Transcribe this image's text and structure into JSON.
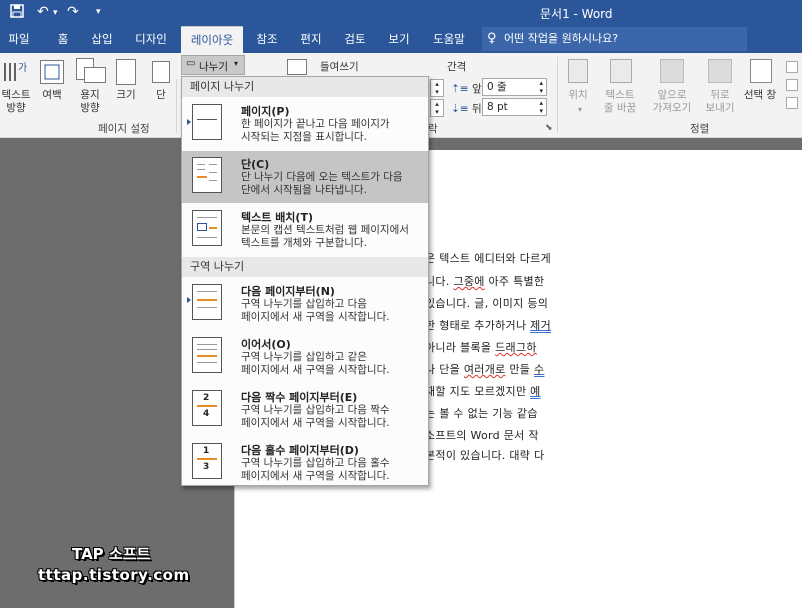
{
  "window": {
    "title": "문서1 - Word"
  },
  "qat": {
    "save_icon": "save-icon",
    "undo_icon": "undo-icon",
    "redo_icon": "redo-icon"
  },
  "tabs": [
    "파일",
    "홈",
    "삽입",
    "디자인",
    "레이아웃",
    "참조",
    "편지",
    "검토",
    "보기",
    "도움말"
  ],
  "tell_me": {
    "placeholder": "어떤 작업을 원하시나요?"
  },
  "ribbon": {
    "text_direction": [
      "텍스트",
      "방향"
    ],
    "margins": "여백",
    "orientation": [
      "용지",
      "방향"
    ],
    "size": "크기",
    "columns": "단",
    "breaks": "나누기",
    "page_setup": "페이지 설정",
    "indent_label": "들여쓰기",
    "spacing_label": "간격",
    "before_label": "앞:",
    "before_value": "0 줄",
    "after_label": "뒤:",
    "after_value": "8 pt",
    "paragraph_fragment": "락",
    "position": "위치",
    "wrap_text": [
      "텍스트",
      "줄 바꿈"
    ],
    "bring_forward": [
      "앞으로",
      "가져오기"
    ],
    "send_backward": [
      "뒤로",
      "보내기"
    ],
    "selection_pane": "선택 창",
    "arrange": "정렬"
  },
  "menu": {
    "title": "나누기",
    "page_breaks_header": "페이지 나누기",
    "section_breaks_header": "구역 나누기",
    "items": [
      {
        "title": "페이지(P)",
        "desc": [
          "한 페이지가 끝나고 다음 페이지가",
          "시작되는 지점을 표시합니다."
        ]
      },
      {
        "title": "단(C)",
        "desc": [
          "단 나누기 다음에 오는 텍스트가 다음",
          "단에서 시작됨을 나타냅니다."
        ]
      },
      {
        "title": "텍스트 배치(T)",
        "desc": [
          "본문의 캡션 텍스트처럼 웹 페이지에서",
          "텍스트를 개체와 구분합니다."
        ]
      },
      {
        "title": "다음 페이지부터(N)",
        "desc": [
          "구역 나누기를 삽입하고 다음",
          "페이지에서 새 구역을 시작합니다."
        ]
      },
      {
        "title": "이어서(O)",
        "desc": [
          "구역 나누기를 삽입하고 같은",
          "페이지에서 새 구역을 시작합니다."
        ]
      },
      {
        "title": "다음 짝수 페이지부터(E)",
        "desc": [
          "구역 나누기를 삽입하고 다음 짝수",
          "페이지에서 새 구역을 시작합니다."
        ]
      },
      {
        "title": "다음 홀수 페이지부터(D)",
        "desc": [
          "구역 나누기를 삽입하고 다음 홀수",
          "페이지에서 새 구역을 시작합니다."
        ]
      }
    ]
  },
  "document": {
    "lines": [
      "은 텍스트 에디터와 다르게",
      "니다. 그중에 아주 특별한",
      "있습니다. 글, 이미지 등의",
      "한 형태로 추가하거나 제거",
      "아니라 블록을 드래그하",
      "나 단을 여러개로 만들 수",
      "재할 지도 모르겠지만 예",
      "는 볼 수 없는 기능 같습",
      "소프트의 Word 문서 작",
      "본적이 있습니다. 대략 다"
    ]
  },
  "watermark": {
    "line1": "TAP 소프트",
    "line2": "tttap.tistory.com"
  }
}
